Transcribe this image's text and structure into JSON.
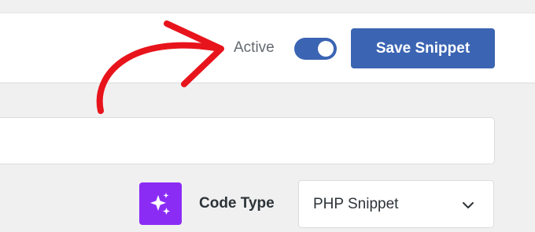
{
  "header": {
    "active_label": "Active",
    "active_toggle_on": true,
    "save_label": "Save Snippet"
  },
  "title_input": {
    "value": "",
    "placeholder": ""
  },
  "code_type": {
    "label": "Code Type",
    "selected": "PHP Snippet",
    "ai_icon": "sparkles-icon",
    "chevron_icon": "chevron-down-icon"
  },
  "annotation": {
    "arrow_icon": "red-arrow-icon"
  },
  "colors": {
    "accent": "#3b64b3",
    "ai_purple": "#8b2cf5",
    "annotation_red": "#e8141c",
    "background": "#f0f0f1"
  }
}
